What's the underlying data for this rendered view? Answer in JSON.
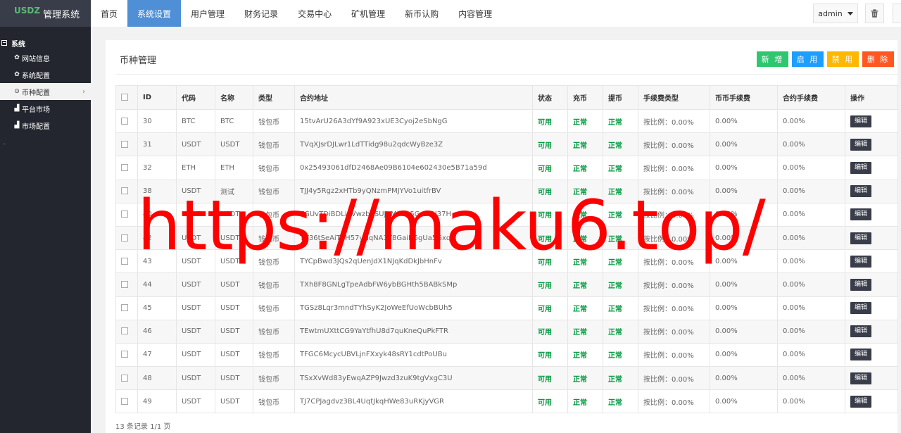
{
  "brand": {
    "logo_text": "USDZ",
    "title": "管理系统"
  },
  "sidebar": {
    "group": "系统",
    "items": [
      {
        "icon": "gear-icon",
        "label": "网站信息",
        "active": false
      },
      {
        "icon": "gear-icon",
        "label": "系统配置",
        "active": false
      },
      {
        "icon": "circle-dot-icon",
        "label": "币种配置",
        "active": true
      },
      {
        "icon": "bar-chart-icon",
        "label": "平台市场",
        "active": false
      },
      {
        "icon": "bar-chart-icon",
        "label": "市场配置",
        "active": false
      }
    ]
  },
  "topnav": {
    "items": [
      {
        "label": "首页",
        "active": false
      },
      {
        "label": "系统设置",
        "active": true
      },
      {
        "label": "用户管理",
        "active": false
      },
      {
        "label": "财务记录",
        "active": false
      },
      {
        "label": "交易中心",
        "active": false
      },
      {
        "label": "矿机管理",
        "active": false
      },
      {
        "label": "新币认购",
        "active": false
      },
      {
        "label": "内容管理",
        "active": false
      }
    ],
    "user": "admin"
  },
  "page": {
    "title": "币种管理",
    "actions": {
      "add": "新 增",
      "enable": "启 用",
      "disable": "禁 用",
      "delete": "删 除"
    }
  },
  "table": {
    "headers": [
      "ID",
      "代码",
      "名称",
      "类型",
      "合约地址",
      "状态",
      "充币",
      "提币",
      "手续费类型",
      "币币手续费",
      "合约手续费",
      "操作"
    ],
    "rows": [
      [
        "30",
        "BTC",
        "BTC",
        "钱包币",
        "15tvArU26A3dYf9A923xUE3Cyoj2eSbNgG",
        "可用",
        "正常",
        "正常",
        "按比例：0.00%",
        "0.00%",
        "0.00%",
        "编辑"
      ],
      [
        "31",
        "USDT",
        "USDT",
        "钱包币",
        "TVqXJsrDJLwr1LdTTidg98u2qdcWyBze3Z",
        "可用",
        "正常",
        "正常",
        "按比例：0.00%",
        "0.00%",
        "0.00%",
        "编辑"
      ],
      [
        "32",
        "ETH",
        "ETH",
        "钱包币",
        "0x25493061dfD2468Ae09B6104e602430e5B71a59d",
        "可用",
        "正常",
        "正常",
        "按比例：0.00%",
        "0.00%",
        "0.00%",
        "编辑"
      ],
      [
        "38",
        "USDT",
        "测试",
        "钱包币",
        "TJJ4y5Rgz2xHTb9yQNzmPMJYVo1uitfrBV",
        "可用",
        "正常",
        "正常",
        "按比例：0.00%",
        "0.00%",
        "0.00%",
        "编辑"
      ],
      [
        "40",
        "USDT",
        "USDT",
        "钱包币",
        "TGUvTDiBDLiEVwzbbSUJhMihm5Gz3sH37H",
        "可用",
        "正常",
        "正常",
        "按比例：0.00%",
        "0.00%",
        "0.00%",
        "编辑"
      ],
      [
        "42",
        "USDT",
        "USDT",
        "钱包币",
        "TV36tSeAiTSH57yNqNA3T8GaiD5gUa5Gxq",
        "可用",
        "正常",
        "正常",
        "按比例：0.00%",
        "0.00%",
        "0.00%",
        "编辑"
      ],
      [
        "43",
        "USDT",
        "USDT",
        "钱包币",
        "TYCpBwd3JQs2qUenJdX1NJqKdDkJbHnFv",
        "可用",
        "正常",
        "正常",
        "按比例：0.00%",
        "0.00%",
        "0.00%",
        "编辑"
      ],
      [
        "44",
        "USDT",
        "USDT",
        "钱包币",
        "TXh8F8GNLgTpeAdbFW6ybBGHth5BABkSMp",
        "可用",
        "正常",
        "正常",
        "按比例：0.00%",
        "0.00%",
        "0.00%",
        "编辑"
      ],
      [
        "45",
        "USDT",
        "USDT",
        "钱包币",
        "TGSz8Lqr3mndTYhSyK2JoWeEfUoWcbBUh5",
        "可用",
        "正常",
        "正常",
        "按比例：0.00%",
        "0.00%",
        "0.00%",
        "编辑"
      ],
      [
        "46",
        "USDT",
        "USDT",
        "钱包币",
        "TEwtmUXttCG9YaYtfhU8d7quKneQuPkFTR",
        "可用",
        "正常",
        "正常",
        "按比例：0.00%",
        "0.00%",
        "0.00%",
        "编辑"
      ],
      [
        "47",
        "USDT",
        "USDT",
        "钱包币",
        "TFGC6McycUBVLjnFXxyk48sRY1cdtPoUBu",
        "可用",
        "正常",
        "正常",
        "按比例：0.00%",
        "0.00%",
        "0.00%",
        "编辑"
      ],
      [
        "48",
        "USDT",
        "USDT",
        "钱包币",
        "TSxXvWd83yEwqAZP9Jwzd3zuK9tgVxgC3U",
        "可用",
        "正常",
        "正常",
        "按比例：0.00%",
        "0.00%",
        "0.00%",
        "编辑"
      ],
      [
        "49",
        "USDT",
        "USDT",
        "钱包币",
        "TJ7CPJagdvz3BL4UqtJkqHWe83uRKjyVGR",
        "可用",
        "正常",
        "正常",
        "按比例：0.00%",
        "0.00%",
        "0.00%",
        "编辑"
      ]
    ]
  },
  "footer": {
    "count_text": "13 条记录 1/1 页"
  },
  "watermark": "https://maku6.top/",
  "colors": {
    "nav_active": "#4e8fd6",
    "sidebar": "#23262e",
    "status_ok": "#009a3e",
    "watermark": "#ff0000"
  }
}
